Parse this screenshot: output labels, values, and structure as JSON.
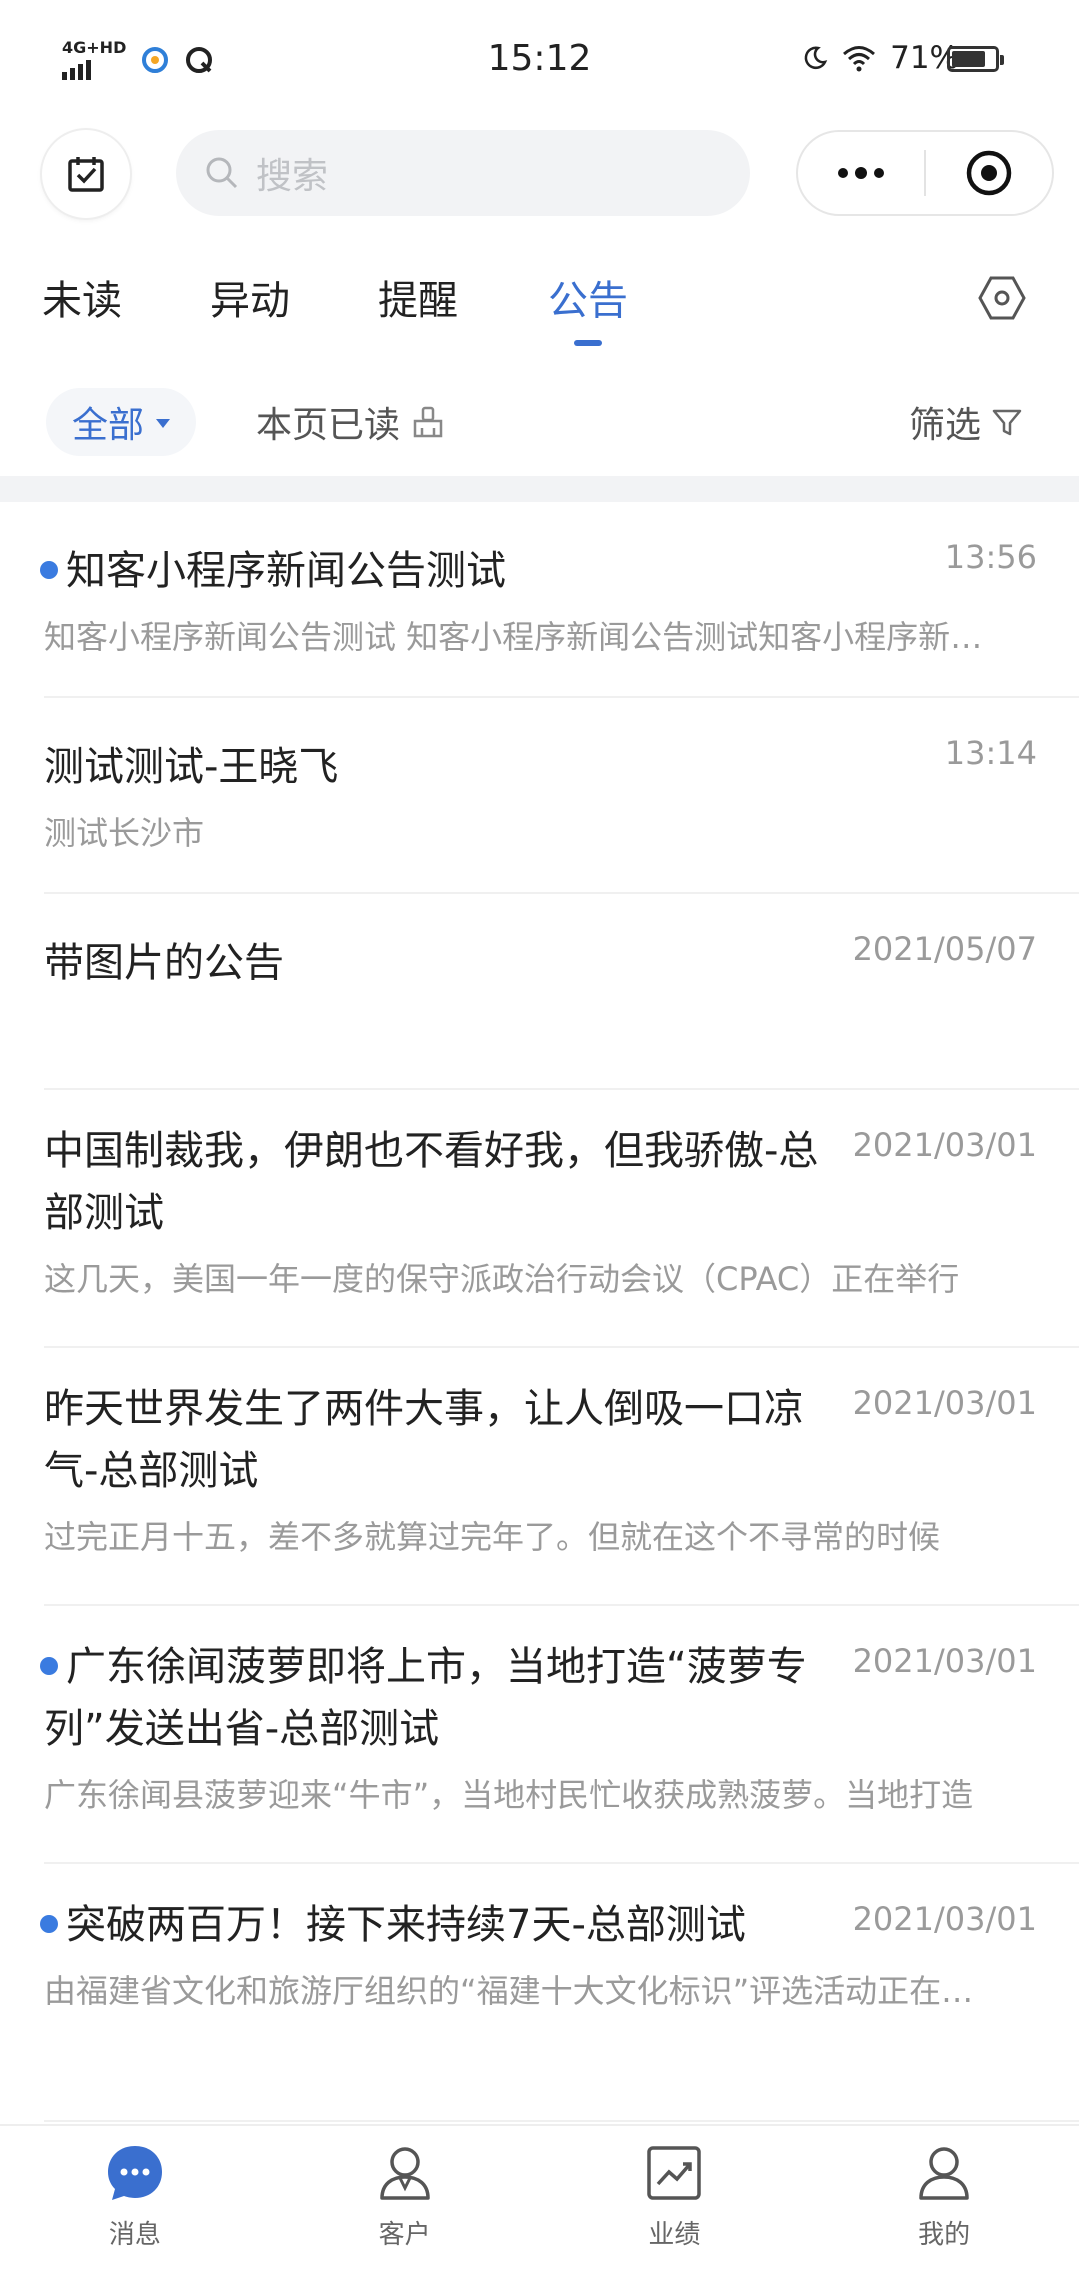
{
  "status_bar": {
    "network": "4G+HD",
    "time": "15:12",
    "battery": "71%"
  },
  "header": {
    "search_placeholder": "搜索"
  },
  "tabs": [
    {
      "label": "未读",
      "active": false
    },
    {
      "label": "异动",
      "active": false
    },
    {
      "label": "提醒",
      "active": false
    },
    {
      "label": "公告",
      "active": true
    }
  ],
  "filter": {
    "all_label": "全部",
    "mark_read_label": "本页已读",
    "filter_label": "筛选"
  },
  "items": [
    {
      "title": "知客小程序新闻公告测试",
      "time": "13:56",
      "summary": "知客小程序新闻公告测试 知客小程序新闻公告测试知客小程序新闻公告测试",
      "unread": true
    },
    {
      "title": "测试测试-王晓飞",
      "time": "13:14",
      "summary": "测试长沙市",
      "unread": false
    },
    {
      "title": "带图片的公告",
      "time": "2021/05/07",
      "summary": "",
      "unread": false
    },
    {
      "title": "中国制裁我，伊朗也不看好我，但我骄傲-总部测试",
      "time": "2021/03/01",
      "summary": "这几天，美国一年一度的保守派政治行动会议（CPAC）正在举行",
      "unread": false
    },
    {
      "title": "昨天世界发生了两件大事，让人倒吸一口凉气-总部测试",
      "time": "2021/03/01",
      "summary": "过完正月十五，差不多就算过完年了。但就在这个不寻常的时候",
      "unread": false
    },
    {
      "title": "广东徐闻菠萝即将上市，当地打造“菠萝专列”发送出省-总部测试",
      "time": "2021/03/01",
      "summary": "广东徐闻县菠萝迎来“牛市”，当地村民忙收获成熟菠萝。当地打造",
      "unread": true
    },
    {
      "title": "突破两百万！接下来持续7天-总部测试",
      "time": "2021/03/01",
      "summary": "由福建省文化和旅游厅组织的“福建十大文化标识”评选活动正在进行",
      "unread": true
    }
  ],
  "bottom_nav": [
    {
      "label": "消息",
      "icon": "message-icon",
      "active": true
    },
    {
      "label": "客户",
      "icon": "customer-icon",
      "active": false
    },
    {
      "label": "业绩",
      "icon": "performance-icon",
      "active": false
    },
    {
      "label": "我的",
      "icon": "profile-icon",
      "active": false
    }
  ],
  "colors": {
    "accent": "#3a6fcf",
    "unread_dot": "#3a7be0",
    "muted_text": "#9a9a9a"
  }
}
